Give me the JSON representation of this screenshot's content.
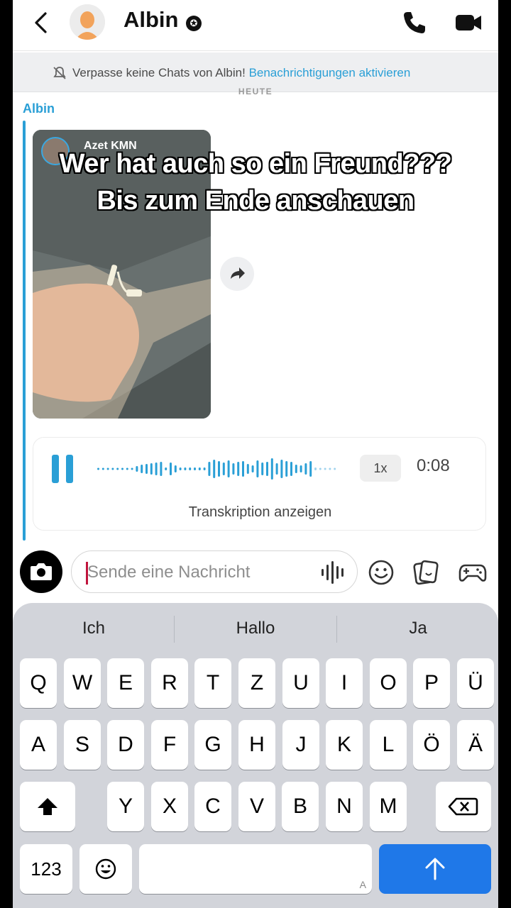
{
  "header": {
    "contact_name": "Albin",
    "badge_icon": "star-icon"
  },
  "banner": {
    "text": "Verpasse keine Chats von Albin!",
    "link": "Benachrichtigungen aktivieren"
  },
  "chat": {
    "date_label": "HEUTE",
    "sender": "Albin",
    "video": {
      "author": "Azet KMN"
    },
    "overlay_caption": [
      "Wer hat auch so ein Freund???",
      "Bis zum Ende anschauen"
    ],
    "voice_note": {
      "speed": "1x",
      "duration": "0:08",
      "transcript_label": "Transkription anzeigen"
    }
  },
  "composer": {
    "placeholder": "Sende eine Nachricht"
  },
  "keyboard": {
    "suggestions": [
      "Ich",
      "Hallo",
      "Ja"
    ],
    "row1": [
      "Q",
      "W",
      "E",
      "R",
      "T",
      "Z",
      "U",
      "I",
      "O",
      "P",
      "Ü"
    ],
    "row2": [
      "A",
      "S",
      "D",
      "F",
      "G",
      "H",
      "J",
      "K",
      "L",
      "Ö",
      "Ä"
    ],
    "row3": [
      "Y",
      "X",
      "C",
      "V",
      "B",
      "N",
      "M"
    ],
    "numbers_key": "123",
    "space_hint": "A"
  },
  "colors": {
    "accent": "#2a9fd6",
    "send_key": "#1f78e8",
    "keyboard_bg": "#d2d4da"
  }
}
